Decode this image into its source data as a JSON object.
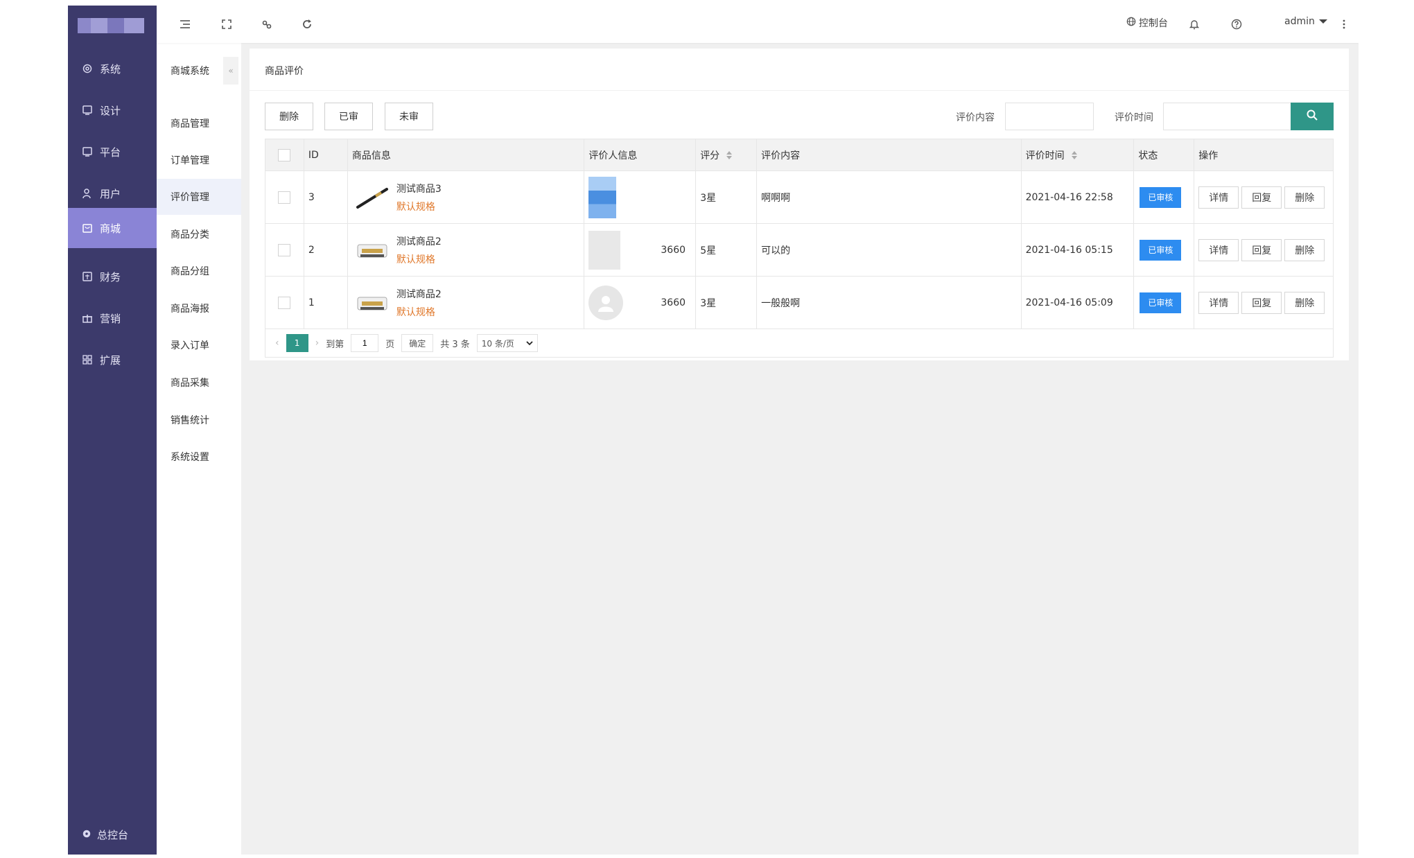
{
  "nav": {
    "items": [
      {
        "label": "系统",
        "icon": "gear-icon"
      },
      {
        "label": "设计",
        "icon": "monitor-icon"
      },
      {
        "label": "平台",
        "icon": "monitor-icon"
      },
      {
        "label": "用户",
        "icon": "user-icon"
      },
      {
        "label": "商城",
        "icon": "shop-icon"
      },
      {
        "label": "财务",
        "icon": "finance-icon"
      },
      {
        "label": "营销",
        "icon": "gift-icon"
      },
      {
        "label": "扩展",
        "icon": "grid-icon"
      }
    ],
    "active_index": 4,
    "bottom_label": "总控台"
  },
  "subnav": {
    "title": "商城系统",
    "items": [
      "商品管理",
      "订单管理",
      "评价管理",
      "商品分类",
      "商品分组",
      "商品海报",
      "录入订单",
      "商品采集",
      "销售统计",
      "系统设置"
    ],
    "active_index": 2
  },
  "topbar": {
    "console_label": "控制台",
    "admin_label": "admin"
  },
  "page": {
    "title": "商品评价",
    "buttons": {
      "delete": "删除",
      "reviewed": "已审",
      "unreviewed": "未审"
    },
    "search": {
      "content_label": "评价内容",
      "time_label": "评价时间",
      "content_value": "",
      "time_value": ""
    }
  },
  "table": {
    "headers": {
      "id": "ID",
      "product": "商品信息",
      "user": "评价人信息",
      "score": "评分",
      "content": "评价内容",
      "time": "评价时间",
      "status": "状态",
      "ops": "操作"
    },
    "rows": [
      {
        "id": "3",
        "product": "测试商品3",
        "spec": "默认规格",
        "user_tail": "",
        "score": "3星",
        "content": "啊啊啊",
        "time": "2021-04-16 22:58",
        "status": "已审核",
        "detail": "详情",
        "reply": "回复",
        "delete": "删除",
        "thumb": "pen"
      },
      {
        "id": "2",
        "product": "测试商品2",
        "spec": "默认规格",
        "user_tail": "3660",
        "score": "5星",
        "content": "可以的",
        "time": "2021-04-16 05:15",
        "status": "已审核",
        "detail": "详情",
        "reply": "回复",
        "delete": "删除",
        "thumb": "printer"
      },
      {
        "id": "1",
        "product": "测试商品2",
        "spec": "默认规格",
        "user_tail": "3660",
        "score": "3星",
        "content": "一般般啊",
        "time": "2021-04-16 05:09",
        "status": "已审核",
        "detail": "详情",
        "reply": "回复",
        "delete": "删除",
        "thumb": "printer"
      }
    ]
  },
  "pager": {
    "current": "1",
    "goto_label": "到第",
    "goto_value": "1",
    "page_label": "页",
    "ok_label": "确定",
    "total_label": "共 3 条",
    "page_size": "10 条/页"
  },
  "colors": {
    "sidebar": "#3c3a6b",
    "sidebar_active": "#8a84d6",
    "accent": "#2f9688",
    "status": "#2d8cf0",
    "spec": "#e0782b"
  }
}
